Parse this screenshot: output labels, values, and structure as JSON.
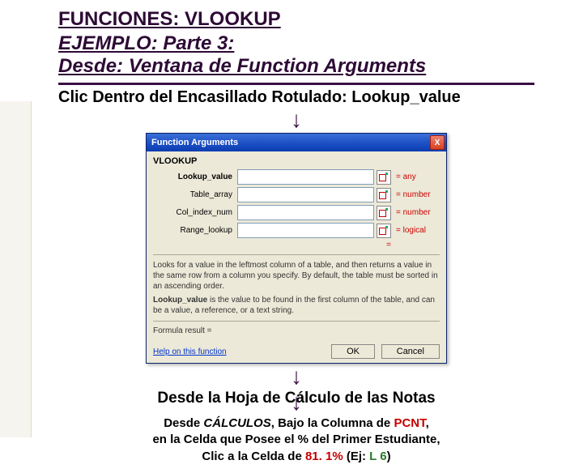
{
  "heading1": "FUNCIONES: VLOOKUP",
  "heading2a": "EJEMPLO: Parte 3:",
  "heading2b_pre": "Desde: Ventana de ",
  "heading2b_em": "Function Arguments",
  "sub_pre": "Clic Dentro del Encasillado Rotulado: ",
  "sub_em": "Lookup_value",
  "arrow": "↓",
  "dialog": {
    "title": "Function Arguments",
    "close": "X",
    "fn": "VLOOKUP",
    "rows": [
      {
        "label": "Lookup_value",
        "bold": true,
        "hint": "= any"
      },
      {
        "label": "Table_array",
        "bold": false,
        "hint": "= number"
      },
      {
        "label": "Col_index_num",
        "bold": false,
        "hint": "= number"
      },
      {
        "label": "Range_lookup",
        "bold": false,
        "hint": "= logical"
      }
    ],
    "eq": "=",
    "desc1": "Looks for a value in the leftmost column of a table, and then returns a value in the same row from a column you specify. By default, the table must be sorted in an ascending order.",
    "desc2_b": "Lookup_value",
    "desc2": " is the value to be found in the first column of the table, and can be a value, a reference, or a text string.",
    "fres": "Formula result =",
    "help": "Help on this function",
    "ok": "OK",
    "cancel": "Cancel"
  },
  "t2": "Desde la Hoja de Cálculo de las Notas",
  "t3": {
    "l1a": "Desde ",
    "l1b": "CÁLCULOS",
    "l1c": ", Bajo la Columna de ",
    "l1d": "PCNT",
    "l1e": ",",
    "l2": "en la Celda que Posee el % del Primer Estudiante,",
    "l3a": "Clic a  la Celda de ",
    "l3b": "81. 1%",
    "l3c": " (Ej: ",
    "l3d": "L 6",
    "l3e": ")"
  }
}
